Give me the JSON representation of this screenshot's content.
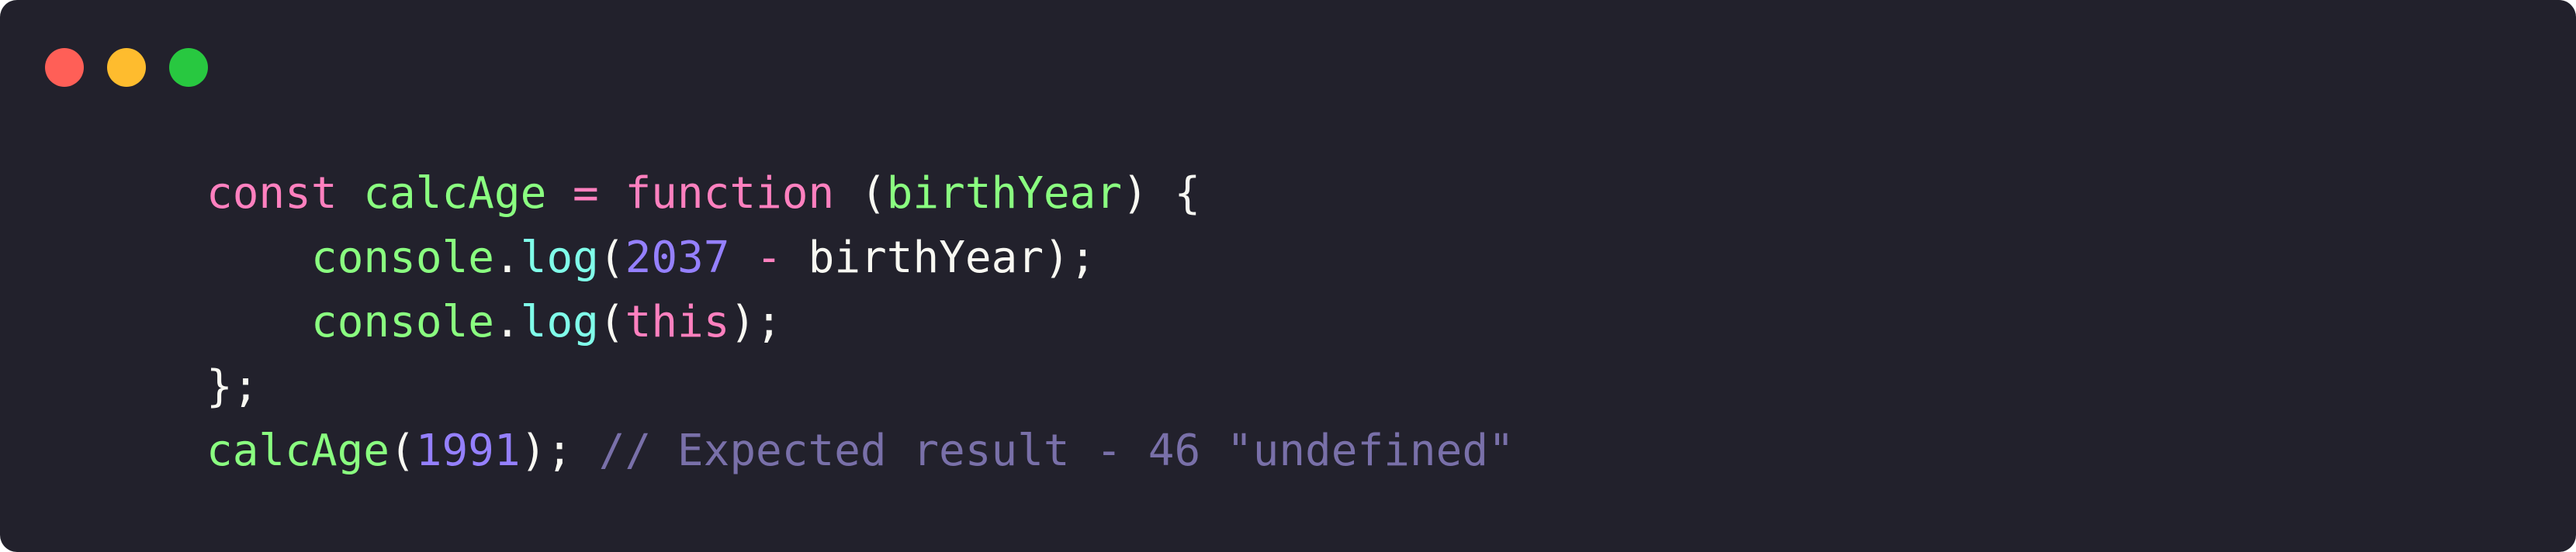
{
  "window": {
    "controls": {
      "close_color": "#ff5f57",
      "minimize_color": "#febc2e",
      "maximize_color": "#28c840"
    }
  },
  "code": {
    "line1": {
      "kw_const": "const",
      "name": "calcAge",
      "eq": "=",
      "kw_function": "function",
      "open_paren": "(",
      "param": "birthYear",
      "close": ") {"
    },
    "line2": {
      "obj": "console",
      "dot": ".",
      "method": "log",
      "open": "(",
      "number": "2037",
      "minus": "-",
      "arg": "birthYear",
      "close": ");"
    },
    "line3": {
      "obj": "console",
      "dot": ".",
      "method": "log",
      "open": "(",
      "this": "this",
      "close": ");"
    },
    "line4": {
      "text": "};"
    },
    "line5": {
      "call": "calcAge",
      "open": "(",
      "number": "1991",
      "close": ");",
      "comment": "// Expected result - 46 \"undefined\""
    }
  }
}
